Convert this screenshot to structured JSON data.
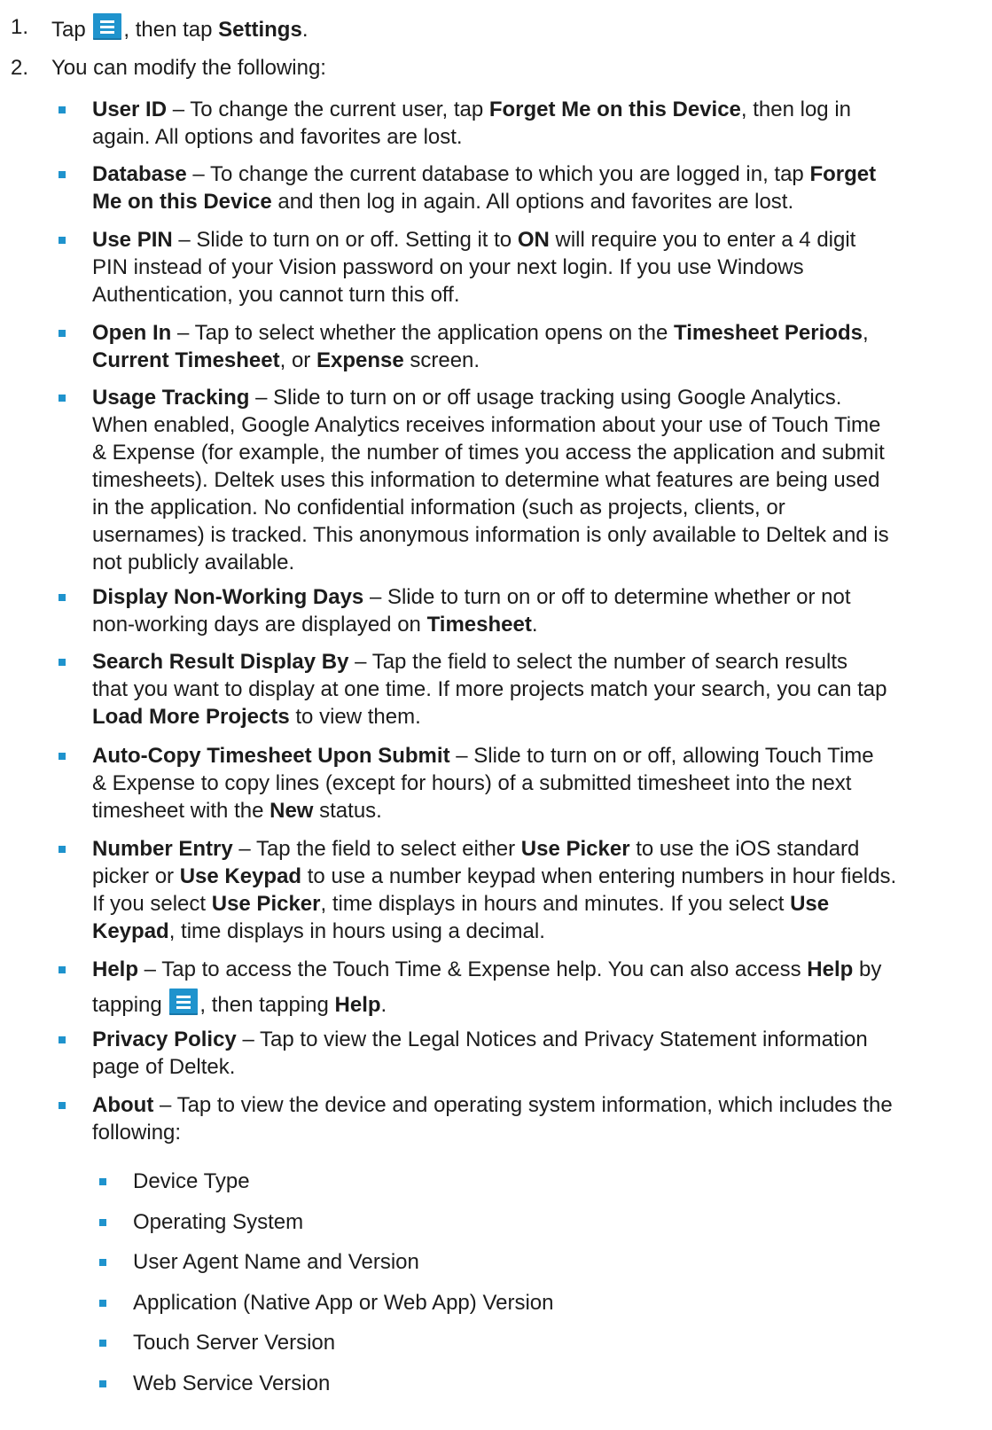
{
  "steps": [
    {
      "num": "1.",
      "a": "Tap ",
      "b": ", then tap ",
      "c": "Settings",
      "d": "."
    },
    {
      "num": "2.",
      "text": "You can modify the following:"
    }
  ],
  "icons": {
    "menu": "hamburger-menu-icon",
    "bullet": "square-bullet",
    "accent": "#1f93cd"
  },
  "items": {
    "user_id": {
      "title": "User ID",
      "l1a": " – To change the current user, tap ",
      "l1b": "Forget Me on this Device",
      "l1c": ", then log in",
      "l2": "again. All options and favorites are lost."
    },
    "database": {
      "title": "Database",
      "l1a": " – To change the current database to which you are logged in, tap ",
      "l1b": "Forget",
      "l2a": "Me on this Device",
      "l2b": " and then log in again. All options and favorites are lost."
    },
    "use_pin": {
      "title": "Use PIN",
      "l1a": "  – Slide to turn on or off. Setting it to ",
      "l1b": "ON",
      "l1c": " will require you to enter a 4 digit",
      "l2": "PIN instead of your Vision password on your next login. If you use Windows",
      "l3": "Authentication, you cannot turn this off."
    },
    "open_in": {
      "title": "Open In",
      "l1a": " – Tap to select whether the application opens on the ",
      "l1b": "Timesheet Periods",
      "l1c": ",",
      "l2a": "Current Timesheet",
      "l2b": ", or ",
      "l2c": "Expense",
      "l2d": " screen."
    },
    "usage_tracking": {
      "title": "Usage Tracking",
      "l1a": " – Slide to turn on or off usage tracking using Google Analytics.",
      "l2": "When enabled, Google Analytics receives information about your use of Touch Time",
      "l3": "& Expense (for example, the number of times you access the application and submit",
      "l4": "timesheets). Deltek uses this information to determine what features are being used",
      "l5": "in the application. No confidential information (such as projects, clients, or",
      "l6": "usernames) is tracked. This anonymous information is only available to Deltek and is",
      "l7": "not publicly available."
    },
    "non_working": {
      "title": "Display Non-Working Days",
      "l1a": " – Slide to turn on or off to determine whether or not",
      "l2a": "non-working days are displayed on ",
      "l2b": "Timesheet",
      "l2c": "."
    },
    "search_result": {
      "title": "Search Result Display By",
      "l1a": "  – Tap the field to select the number of search results",
      "l2": "that you want to display at one time. If more projects match your search, you can tap",
      "l3a": "Load More Projects",
      "l3b": " to view them."
    },
    "auto_copy": {
      "title": "Auto-Copy Timesheet Upon Submit",
      "l1a": " – Slide to turn on or off, allowing Touch Time",
      "l2": "& Expense to copy lines (except for hours) of a submitted timesheet into the next",
      "l3a": "timesheet with the ",
      "l3b": "New",
      "l3c": " status."
    },
    "number_entry": {
      "title": "Number Entry",
      "l1a": " – Tap the field to select either ",
      "l1b": "Use Picker",
      "l1c": " to use the iOS standard",
      "l2a": "picker or ",
      "l2b": "Use Keypad",
      "l2c": " to use a number keypad when entering numbers in hour fields.",
      "l3a": "If you select ",
      "l3b": "Use Picker",
      "l3c": ", time displays in hours and minutes. If you select ",
      "l3d": "Use",
      "l4a": "Keypad",
      "l4b": ", time displays in hours using a decimal."
    },
    "help": {
      "title": "Help",
      "l1a": " – Tap to access the Touch Time & Expense help. You can also access ",
      "l1b": "Help",
      "l1c": " by",
      "l2a": "tapping ",
      "l2b": ", then tapping ",
      "l2c": "Help",
      "l2d": "."
    },
    "privacy": {
      "title": "Privacy Policy",
      "l1a": " – Tap to view the Legal Notices and Privacy Statement information",
      "l2": "page of Deltek."
    },
    "about": {
      "title": "About",
      "l1a": " – Tap to view the device and operating system information, which includes the",
      "l2": "following:"
    }
  },
  "about_list": [
    "Device Type",
    "Operating System",
    "User Agent Name and Version",
    "Application (Native App or Web App) Version",
    "Touch Server Version",
    "Web Service Version"
  ]
}
